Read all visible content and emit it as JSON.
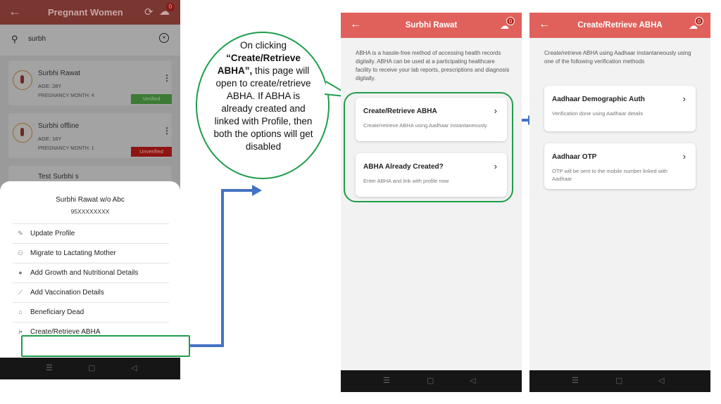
{
  "phone1": {
    "header_title": "Pregnant Women",
    "notification_count": "0",
    "search_value": "surbh",
    "cards": [
      {
        "name": "Surbhi Rawat",
        "age": "AGE: 28Y",
        "preg_month": "PREGNANCY MONTH: 4",
        "status": "Verified"
      },
      {
        "name": "Surbhi offline",
        "age": "AGE: 16Y",
        "preg_month": "PREGNANCY MONTH: 1",
        "status": "Unverified"
      },
      {
        "name": "Test Surbhi s"
      }
    ],
    "sheet": {
      "name": "Surbhi Rawat w/o Abc",
      "phone": "95XXXXXXXX",
      "items": [
        "Update Profile",
        "Migrate to Lactating Mother",
        "Add Growth and Nutritional Details",
        "Add Vaccination Details",
        "Beneficiary Dead",
        "Create/Retrieve ABHA"
      ]
    }
  },
  "callout": {
    "line1": "On clicking",
    "bold": "“Create/Retrieve ABHA”,",
    "rest": "this page will open to create/retrieve ABHA. If ABHA is already created and linked with Profile, then both the options will get disabled"
  },
  "phone2": {
    "header_title": "Surbhi Rawat",
    "notification_count": "0",
    "intro": "ABHA is a hassle-free method of accessing health records digitally. ABHA can be used at a participating healthcare facility to receive your lab reports, prescriptions and diagnosis digitally.",
    "cards": [
      {
        "title": "Create/Retrieve ABHA",
        "desc": "Create/retrieve ABHA using Aadhaar instantaneously."
      },
      {
        "title": "ABHA Already Created?",
        "desc": "Enter ABHA and link with profile now"
      }
    ]
  },
  "phone3": {
    "header_title": "Create/Retrieve ABHA",
    "notification_count": "0",
    "intro": "Create/retrieve ABHA using Aadhaar instantaneously using one of the following verification methods",
    "cards": [
      {
        "title": "Aadhaar Demographic Auth",
        "desc": "Verification done using Aadhaar details"
      },
      {
        "title": "Aadhaar OTP",
        "desc": "OTP will be sent to the mobile number linked with Aadhaar"
      }
    ]
  },
  "icons": {
    "back": "←",
    "chevron": "›",
    "search": "⚲",
    "clear": "×",
    "menu_dots": "⋮",
    "sync": "⟳",
    "nav_menu": "☰",
    "nav_home": "▢",
    "nav_back": "◁"
  },
  "colors": {
    "header_red": "#e0615b",
    "highlight_green": "#1f9d4a",
    "arrow_blue": "#4472c4"
  }
}
